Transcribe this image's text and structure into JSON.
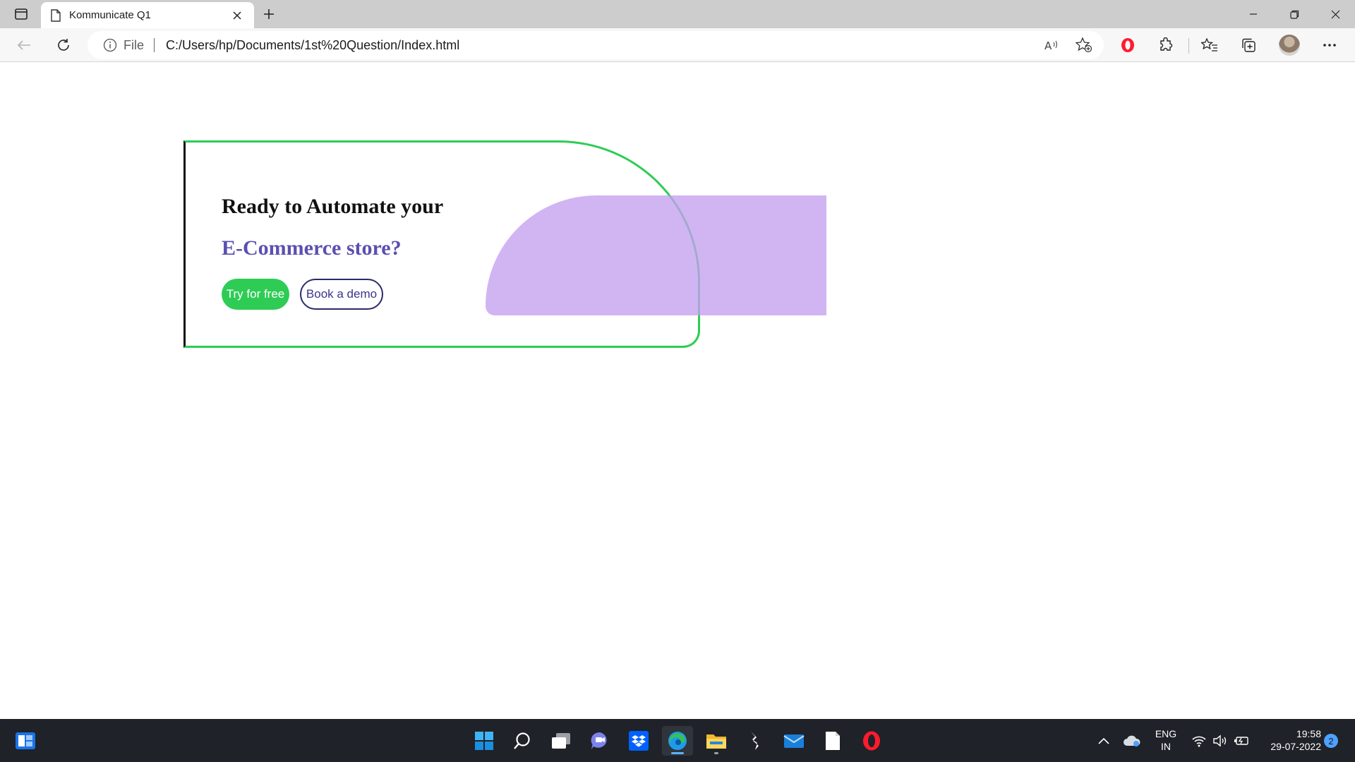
{
  "browser": {
    "tab": {
      "title": "Kommunicate Q1"
    },
    "address": {
      "scheme_label": "File",
      "url": "C:/Users/hp/Documents/1st%20Question/Index.html"
    },
    "icons": {
      "tab_actions": "tab-actions-icon",
      "page": "document-icon",
      "close": "close-icon",
      "new_tab": "plus-icon",
      "back": "back-arrow-icon",
      "refresh": "refresh-icon",
      "info": "info-icon",
      "read_aloud": "read-aloud-icon",
      "favorite": "add-favorite-icon",
      "opera": "opera-extension-icon",
      "extensions": "extensions-icon",
      "favorites": "favorites-icon",
      "collections": "collections-icon",
      "profile": "avatar",
      "menu": "more-icon"
    }
  },
  "page": {
    "cta": {
      "heading": "Ready to Automate your",
      "subheading": "E-Commerce store?",
      "primary_button": "Try for free",
      "secondary_button": "Book a demo"
    },
    "colors": {
      "accent_green": "#2ecc55",
      "accent_purple": "#5b4fb0",
      "blob_purple": "#c4a0f0",
      "button_outline": "#2c2a6a"
    }
  },
  "taskbar": {
    "language": {
      "line1": "ENG",
      "line2": "IN"
    },
    "clock": {
      "time": "19:58",
      "date": "29-07-2022"
    },
    "notification_count": "2",
    "apps": [
      "start-icon",
      "search-icon",
      "task-view-icon",
      "chat-icon",
      "dropbox-icon",
      "edge-icon",
      "file-explorer-icon",
      "sublime-icon",
      "mail-icon",
      "notepad-icon",
      "opera-icon"
    ]
  }
}
